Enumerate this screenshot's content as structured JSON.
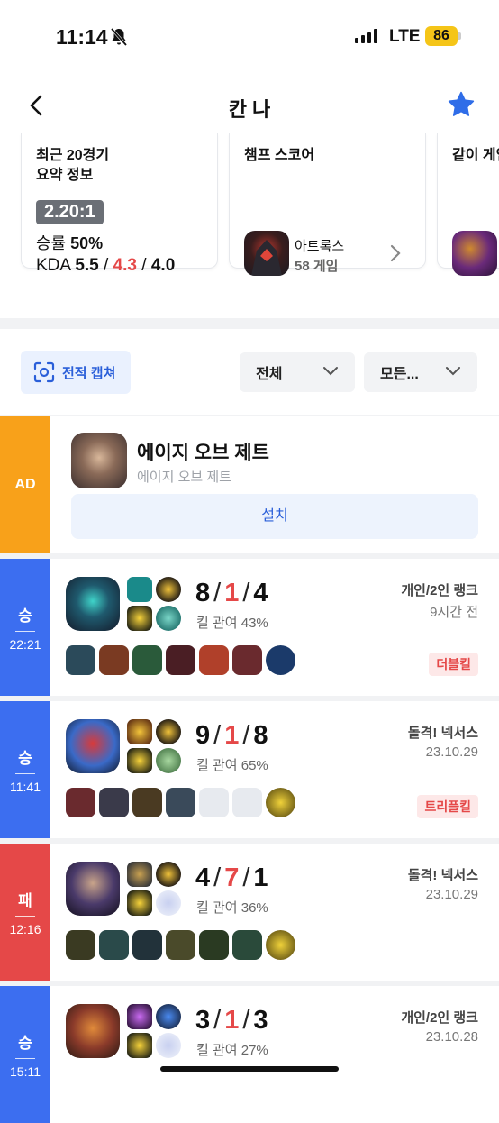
{
  "status": {
    "time": "11:14",
    "network": "LTE",
    "battery": "86"
  },
  "header": {
    "title": "칸 나"
  },
  "cards": [
    {
      "heading": "최근 20경기\n요약 정보",
      "ratio": "2.20:1",
      "winrate_label": "승률",
      "winrate": "50%",
      "kda_label": "KDA",
      "kills": "5.5",
      "deaths": "4.3",
      "assists": "4.0"
    },
    {
      "heading": "챔프 스코어",
      "champion": "아트록스",
      "games": "58 게임"
    },
    {
      "heading": "같이 게임"
    }
  ],
  "filters": {
    "capture": "전적 캡쳐",
    "queue": "전체",
    "champion": "모든..."
  },
  "ad": {
    "label": "AD",
    "title": "에이지 오브 제트",
    "subtitle": "에이지 오브 제트",
    "install": "설치"
  },
  "matches": [
    {
      "result": "승",
      "duration": "22:21",
      "kills": "8",
      "deaths": "1",
      "assists": "4",
      "kill_participation": "킬 관여 43%",
      "queue": "개인/2인 랭크",
      "time": "9시간 전",
      "multikill": "더블킬",
      "outcome_color": "#3c6ef0"
    },
    {
      "result": "승",
      "duration": "11:41",
      "kills": "9",
      "deaths": "1",
      "assists": "8",
      "kill_participation": "킬 관여 65%",
      "queue": "돌격! 넥서스",
      "time": "23.10.29",
      "multikill": "트리플킬",
      "outcome_color": "#3c6ef0"
    },
    {
      "result": "패",
      "duration": "12:16",
      "kills": "4",
      "deaths": "7",
      "assists": "1",
      "kill_participation": "킬 관여 36%",
      "queue": "돌격! 넥서스",
      "time": "23.10.29",
      "multikill": "",
      "outcome_color": "#e54848"
    },
    {
      "result": "승",
      "duration": "15:11",
      "kills": "3",
      "deaths": "1",
      "assists": "3",
      "kill_participation": "킬 관여 27%",
      "queue": "개인/2인 랭크",
      "time": "23.10.28",
      "multikill": "",
      "outcome_color": "#3c6ef0"
    }
  ]
}
